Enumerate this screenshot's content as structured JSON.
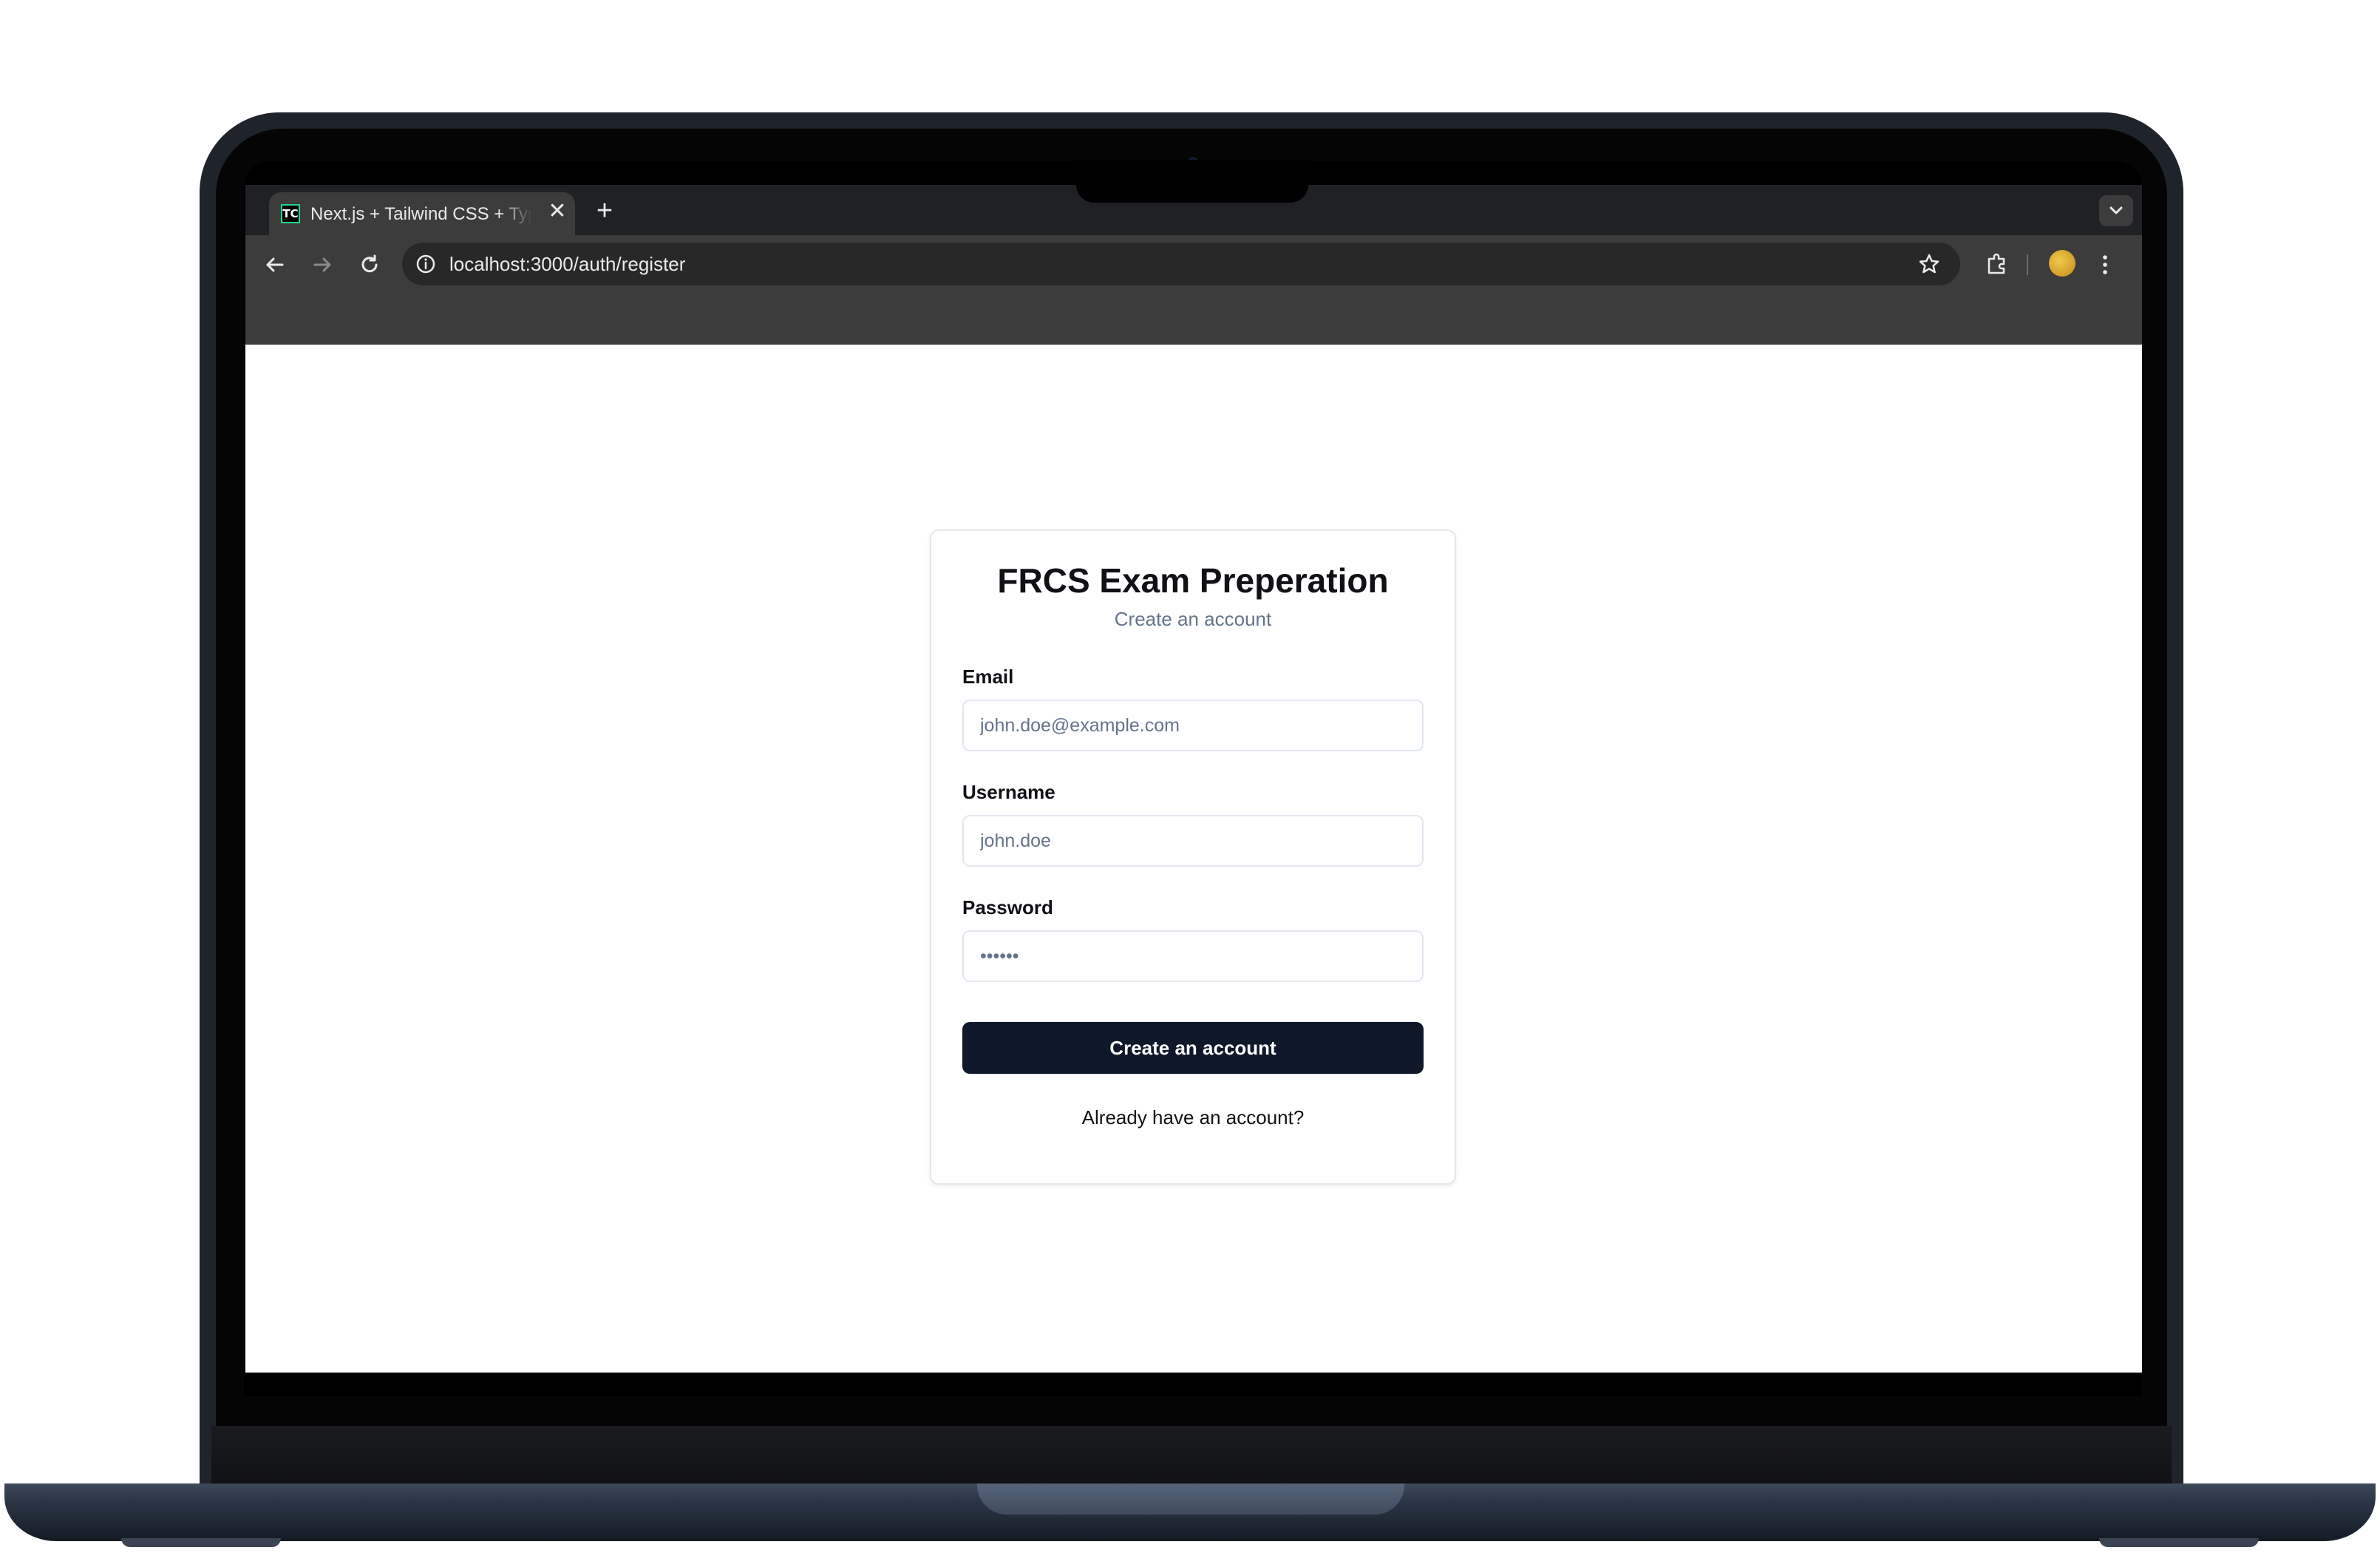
{
  "browser": {
    "tab": {
      "favicon_text": "TC",
      "title": "Next.js + Tailwind CSS + TypeScript Starter",
      "close_glyph": "✕"
    },
    "new_tab_glyph": "+",
    "address_bar": {
      "url": "localhost:3000/auth/register"
    }
  },
  "page": {
    "title": "FRCS Exam Preperation",
    "subtitle": "Create an account",
    "form": {
      "email": {
        "label": "Email",
        "placeholder": "john.doe@example.com",
        "value": ""
      },
      "username": {
        "label": "Username",
        "placeholder": "john.doe",
        "value": ""
      },
      "password": {
        "label": "Password",
        "placeholder": "••••••",
        "value": ""
      },
      "submit_label": "Create an account"
    },
    "login_link": "Already have an account?"
  },
  "colors": {
    "primary_button": "#0f172a",
    "muted_text": "#64748b",
    "browser_chrome": "#3c3c3c"
  }
}
